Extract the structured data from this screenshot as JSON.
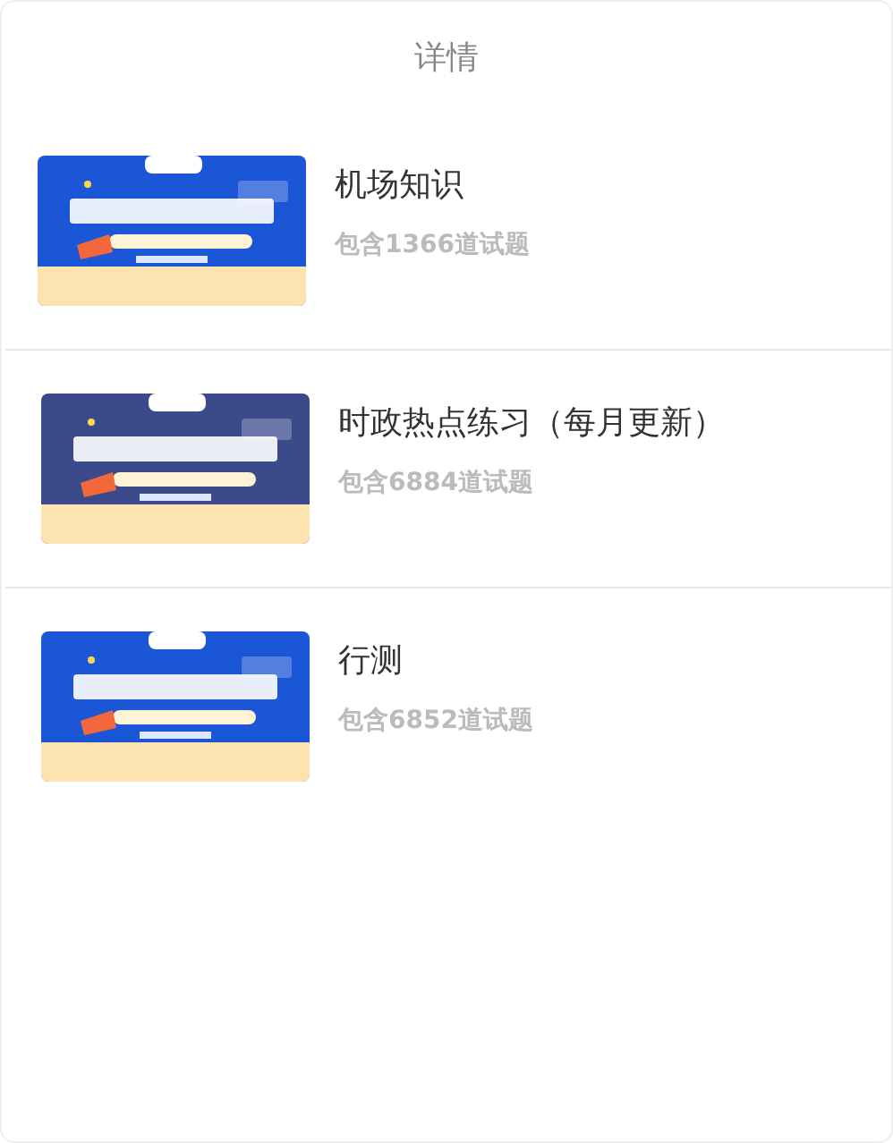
{
  "header": {
    "title": "详情"
  },
  "items": [
    {
      "title": "机场知识",
      "subtitle": "包含1366道试题"
    },
    {
      "title": "时政热点练习（每月更新）",
      "subtitle": "包含6884道试题"
    },
    {
      "title": "行测",
      "subtitle": "包含6852道试题"
    }
  ]
}
